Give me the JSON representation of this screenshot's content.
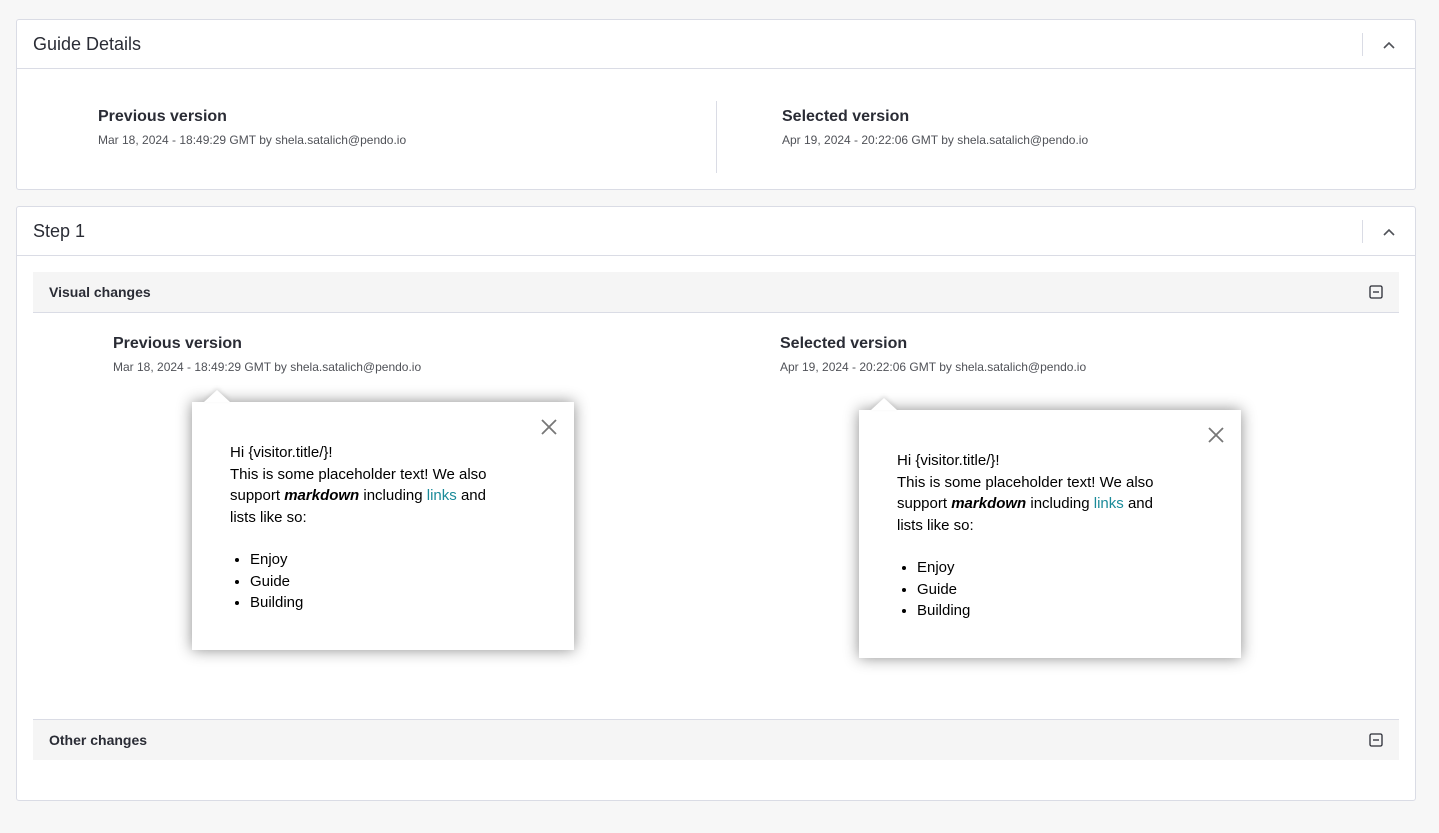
{
  "guide_details": {
    "title": "Guide Details",
    "previous": {
      "title": "Previous version",
      "meta": "Mar 18, 2024 - 18:49:29 GMT by shela.satalich@pendo.io"
    },
    "selected": {
      "title": "Selected version",
      "meta": "Apr 19, 2024 - 20:22:06 GMT by shela.satalich@pendo.io"
    }
  },
  "step": {
    "title": "Step 1",
    "visual_changes": {
      "title": "Visual changes",
      "previous": {
        "title": "Previous version",
        "meta": "Mar 18, 2024 - 18:49:29 GMT by shela.satalich@pendo.io"
      },
      "selected": {
        "title": "Selected version",
        "meta": "Apr 19, 2024 - 20:22:06 GMT by shela.satalich@pendo.io"
      }
    },
    "other_changes": {
      "title": "Other changes"
    }
  },
  "guide_content": {
    "greeting": "Hi {visitor.title/}!",
    "line1": "This is some placeholder text!  We also",
    "line2_pre": "support ",
    "markdown": "markdown",
    "line2_mid": " including ",
    "link": "links",
    "line2_post": " and",
    "line3": "lists like so:",
    "items": [
      "Enjoy",
      "Guide",
      "Building"
    ]
  },
  "colors": {
    "link": "#1a8a99",
    "border": "#dadce5",
    "page_bg": "#f7f7f7"
  },
  "icons": {
    "collapse": "chevron-up-icon",
    "subsection": "minus-square-icon",
    "close": "close-icon"
  }
}
